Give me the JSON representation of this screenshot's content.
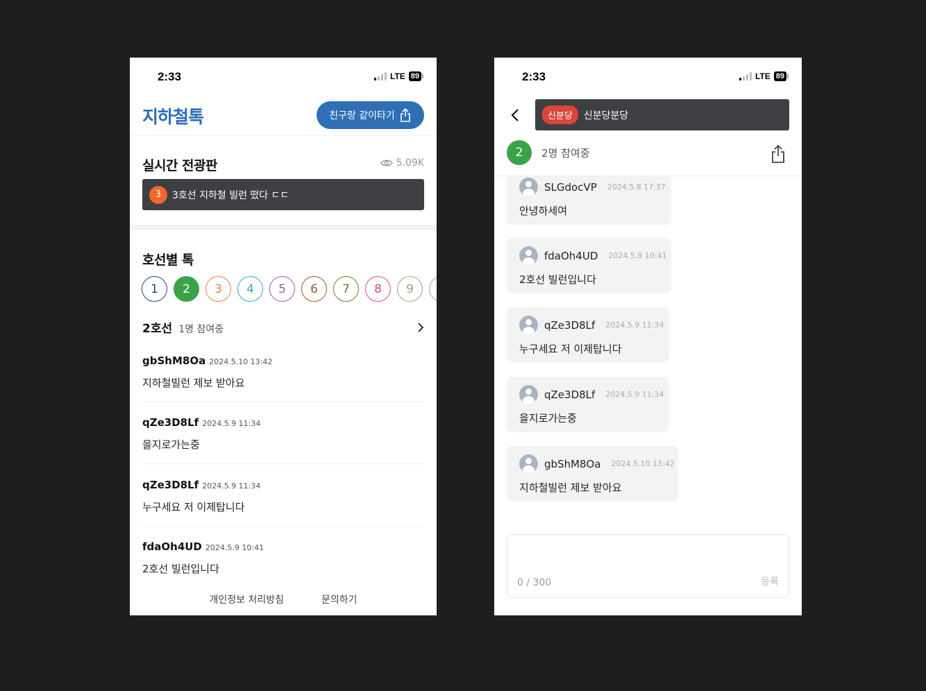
{
  "left": {
    "status": {
      "time": "2:33",
      "network": "LTE",
      "battery": "89"
    },
    "brand": "지하철톡",
    "share_label": "친구랑 같이타기",
    "realtime": {
      "title": "실시간 전광판",
      "views": "5.09K",
      "board_number": "3",
      "board_text": "3호선 지하철 빌런 떴다 ㄷㄷ"
    },
    "lines_section": {
      "title": "호선별 톡",
      "lines": [
        {
          "label": "1",
          "color": "#1f3f8f"
        },
        {
          "label": "2",
          "color": "#3aa34a"
        },
        {
          "label": "3",
          "color": "#ef7a3a"
        },
        {
          "label": "4",
          "color": "#3aa3d8"
        },
        {
          "label": "5",
          "color": "#9a5bb5"
        },
        {
          "label": "6",
          "color": "#a0572c"
        },
        {
          "label": "7",
          "color": "#6f7a2e"
        },
        {
          "label": "8",
          "color": "#d84a84"
        },
        {
          "label": "9",
          "color": "#a99a84"
        }
      ],
      "selected_line": "2호선",
      "participants": "1명 참여중"
    },
    "posts": [
      {
        "user": "gbShM8Oa",
        "time": "2024.5.10 13:42",
        "body": "지하철빌런 제보 받아요"
      },
      {
        "user": "qZe3D8Lf",
        "time": "2024.5.9 11:34",
        "body": "을지로가는중"
      },
      {
        "user": "qZe3D8Lf",
        "time": "2024.5.9 11:34",
        "body": "누구세요 저 이제탑니다"
      },
      {
        "user": "fdaOh4UD",
        "time": "2024.5.9 10:41",
        "body": "2호선 빌런입니다"
      }
    ],
    "footer": {
      "privacy": "개인정보 처리방침",
      "contact": "문의하기"
    }
  },
  "right": {
    "status": {
      "time": "2:33",
      "network": "LTE",
      "battery": "89"
    },
    "room_tag": "신분당",
    "room_name": "신분당분당",
    "participant_count": "2",
    "participant_text": "2명 참여중",
    "messages": [
      {
        "user": "SLGdocVP",
        "time": "2024.5.8 17:37",
        "body": "안녕하세여"
      },
      {
        "user": "fdaOh4UD",
        "time": "2024.5.9 10:41",
        "body": "2호선 빌런입니다"
      },
      {
        "user": "qZe3D8Lf",
        "time": "2024.5.9 11:34",
        "body": "누구세요 저 이제탑니다"
      },
      {
        "user": "qZe3D8Lf",
        "time": "2024.5.9 11:34",
        "body": "을지로가는중"
      },
      {
        "user": "gbShM8Oa",
        "time": "2024.5.10 13:42",
        "body": "지하철빌런 제보 받아요"
      }
    ],
    "input": {
      "char_count": "0 / 300",
      "submit_label": "등록"
    }
  }
}
